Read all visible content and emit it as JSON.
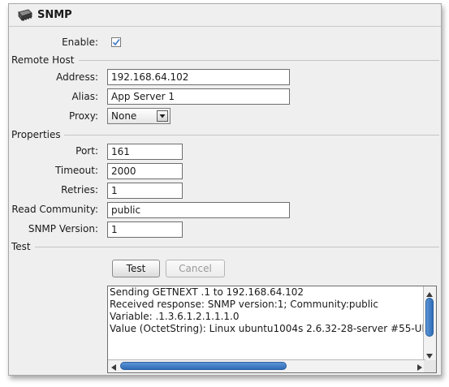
{
  "header": {
    "title": "SNMP",
    "icon": "chip-icon"
  },
  "enable": {
    "label": "Enable:",
    "checked": true
  },
  "remote_host": {
    "heading": "Remote Host",
    "address": {
      "label": "Address:",
      "value": "192.168.64.102"
    },
    "alias": {
      "label": "Alias:",
      "value": "App Server 1"
    },
    "proxy": {
      "label": "Proxy:",
      "selected": "None"
    }
  },
  "properties": {
    "heading": "Properties",
    "port": {
      "label": "Port:",
      "value": "161"
    },
    "timeout": {
      "label": "Timeout:",
      "value": "2000"
    },
    "retries": {
      "label": "Retries:",
      "value": "1"
    },
    "read_community": {
      "label": "Read Community:",
      "value": "public"
    },
    "snmp_version": {
      "label": "SNMP Version:",
      "value": "1"
    }
  },
  "test": {
    "heading": "Test",
    "test_button": "Test",
    "cancel_button": "Cancel",
    "log": [
      "Sending GETNEXT .1 to 192.168.64.102",
      "Received response: SNMP version:1; Community:public",
      "Variable: .1.3.6.1.2.1.1.1.0",
      "Value (OctetString): Linux ubuntu1004s 2.6.32-28-server #55-Ub"
    ]
  },
  "colors": {
    "accent": "#4a7fc8",
    "panel_bg": "#efefef",
    "border": "#6e6e6e"
  }
}
